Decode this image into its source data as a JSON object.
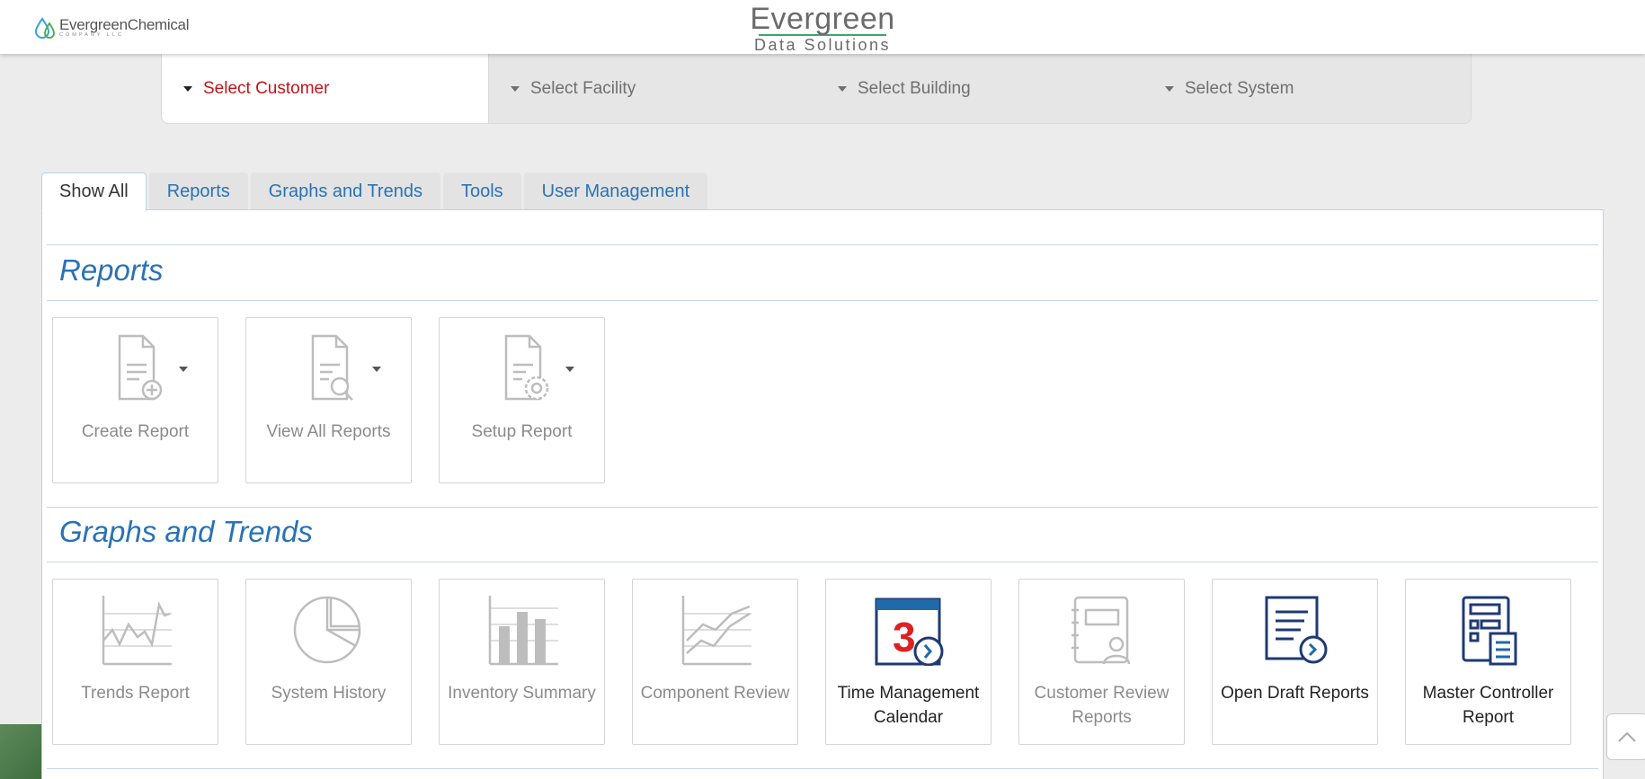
{
  "header": {
    "left_brand": {
      "name": "EvergreenChemical",
      "sub": "COMPANY LLC"
    },
    "center_brand": {
      "line1": "Evergreen",
      "line2": "Data Solutions"
    }
  },
  "selectors": [
    {
      "label": "Select Customer"
    },
    {
      "label": "Select Facility"
    },
    {
      "label": "Select Building"
    },
    {
      "label": "Select System"
    }
  ],
  "tabs": [
    {
      "label": "Show All"
    },
    {
      "label": "Reports"
    },
    {
      "label": "Graphs and Trends"
    },
    {
      "label": "Tools"
    },
    {
      "label": "User Management"
    }
  ],
  "sections": {
    "reports": {
      "title": "Reports",
      "cards": [
        {
          "label": "Create Report",
          "icon": "create-report-icon"
        },
        {
          "label": "View All Reports",
          "icon": "view-reports-icon"
        },
        {
          "label": "Setup Report",
          "icon": "setup-report-icon"
        }
      ]
    },
    "graphs": {
      "title": "Graphs and Trends",
      "cards": [
        {
          "label": "Trends Report",
          "icon": "line-chart-icon"
        },
        {
          "label": "System History",
          "icon": "pie-chart-icon"
        },
        {
          "label": "Inventory Summary",
          "icon": "bar-chart-icon"
        },
        {
          "label": "Component Review",
          "icon": "multi-line-chart-icon"
        },
        {
          "label": "Time Management Calendar",
          "icon": "calendar-icon",
          "badge": "3"
        },
        {
          "label": "Customer Review Reports",
          "icon": "customer-review-icon"
        },
        {
          "label": "Open Draft Reports",
          "icon": "draft-report-icon"
        },
        {
          "label": "Master Controller Report",
          "icon": "controller-report-icon"
        }
      ]
    }
  },
  "colors": {
    "accent": "#2a72b6",
    "active_selector": "#c0151b",
    "dark_icon": "#1f3a73",
    "calendar_number": "#e02020"
  }
}
